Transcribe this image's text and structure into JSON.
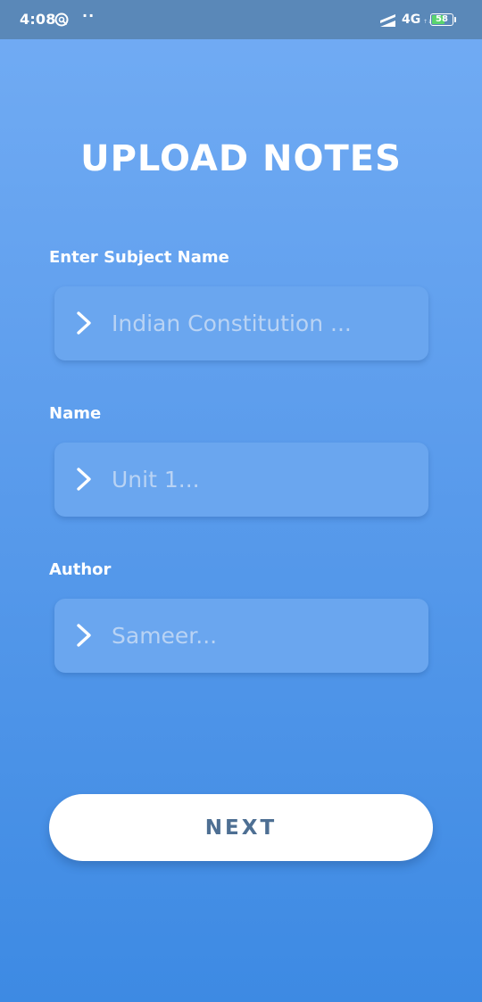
{
  "status_bar": {
    "time": "4:08",
    "dots": "··",
    "network": "4G",
    "network_arrows": "↑↓",
    "battery_level": "58"
  },
  "page": {
    "title": "UPLOAD NOTES"
  },
  "form": {
    "fields": [
      {
        "label": "Enter Subject Name",
        "placeholder": "Indian Constitution ...",
        "icon": "chevron-right-icon"
      },
      {
        "label": "Name",
        "placeholder": "Unit 1...",
        "icon": "chevron-right-icon"
      },
      {
        "label": "Author",
        "placeholder": "Sameer...",
        "icon": "chevron-right-icon"
      }
    ],
    "next_label": "NEXT"
  },
  "colors": {
    "background_top": "#72acf4",
    "background_bottom": "#3d8ae3",
    "status_bar": "#5a88b8",
    "field_background": "#6aa6ef",
    "placeholder_text": "#b9d3f4",
    "button_background": "#ffffff",
    "button_text": "#4e6f93",
    "battery_fill": "#5ad46e"
  }
}
